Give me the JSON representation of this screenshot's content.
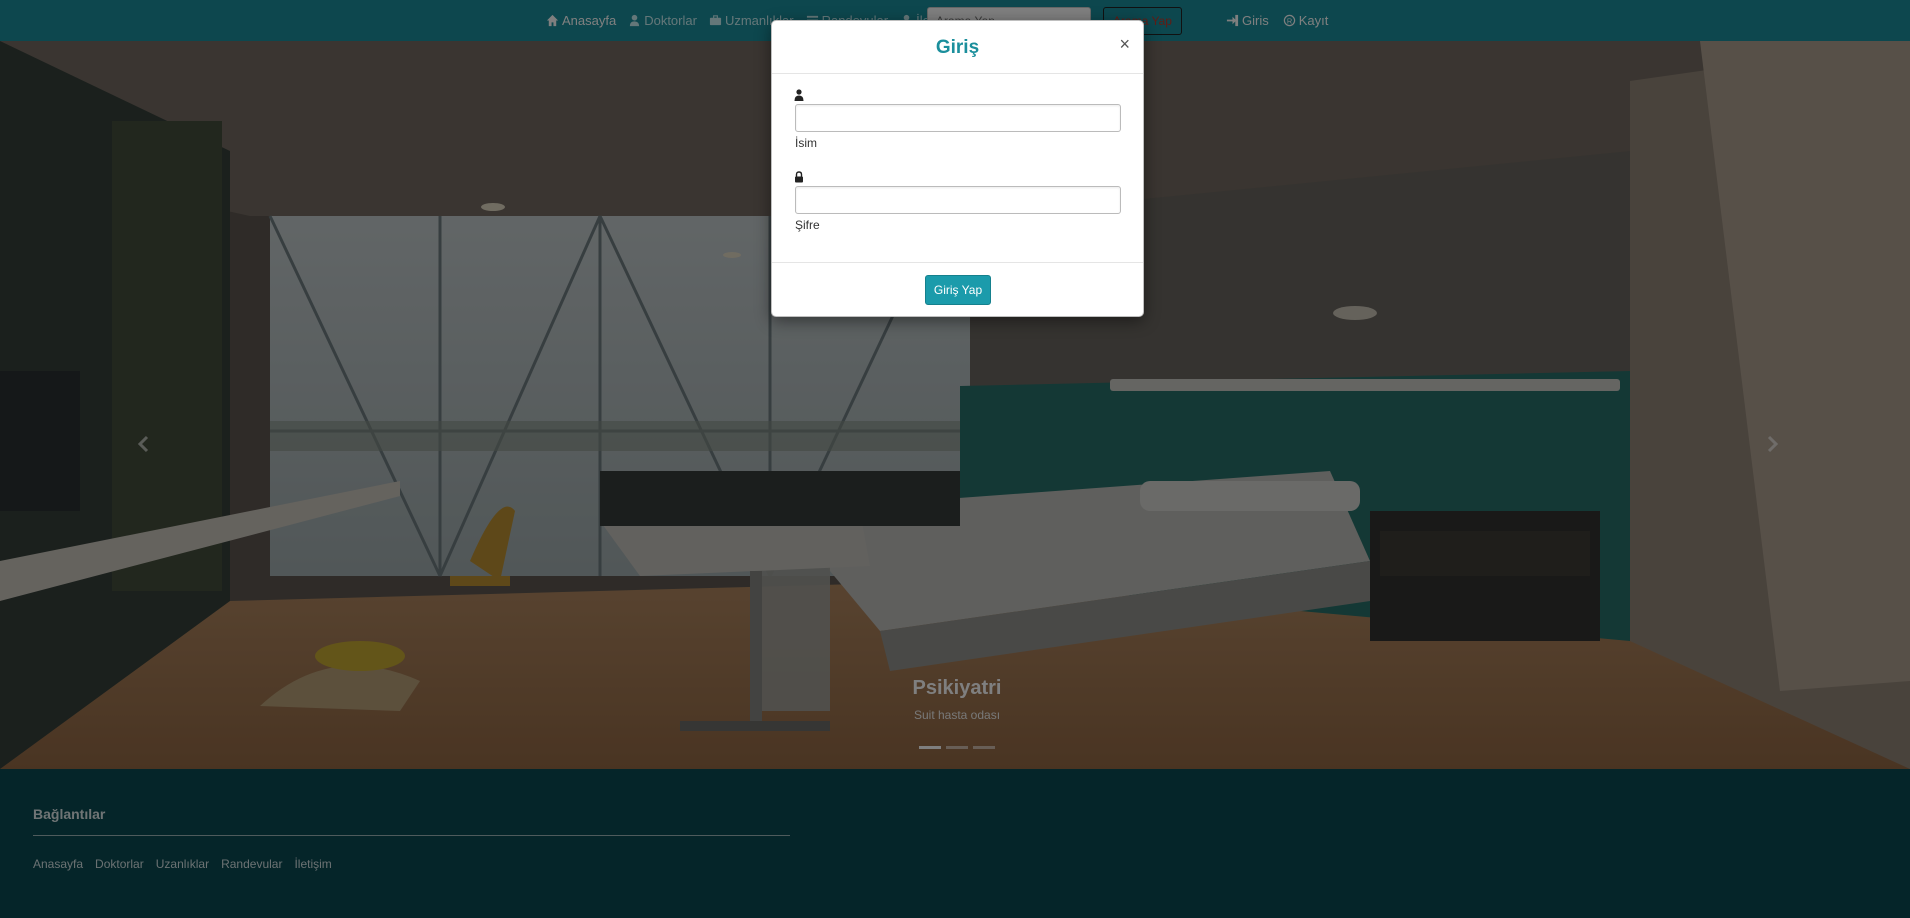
{
  "navbar": {
    "items": [
      {
        "label": "Anasayfa",
        "icon": "home-icon"
      },
      {
        "label": "Doktorlar",
        "icon": "user-md-icon"
      },
      {
        "label": "Uzmanlıklar",
        "icon": "briefcase-icon"
      },
      {
        "label": "Randevular",
        "icon": "list-icon"
      },
      {
        "label": "İletişim",
        "icon": "user-icon"
      }
    ],
    "search_placeholder": "Arama Yap",
    "search_button": "Arama Yap",
    "login_label": "Giris",
    "register_label": "Kayıt"
  },
  "carousel": {
    "caption_title": "Psikiyatri",
    "caption_subtitle": "Suit hasta odası",
    "slide_count": 3,
    "active_index": 0,
    "prev_icon": "chevron-left-icon",
    "next_icon": "chevron-right-icon"
  },
  "modal": {
    "title": "Giriş",
    "close_symbol": "×",
    "username_icon": "user-icon",
    "username_label": "İsim",
    "username_value": "",
    "password_icon": "lock-icon",
    "password_label": "Şifre",
    "password_value": "",
    "submit_label": "Giriş Yap"
  },
  "footer": {
    "heading": "Bağlantılar",
    "links": [
      "Anasayfa",
      "Doktorlar",
      "Uzanlıklar",
      "Randevular",
      "İletişim"
    ]
  },
  "colors": {
    "accent": "#1b8f9c",
    "footer_bg": "#0b4a52",
    "button": "#1b9bab"
  }
}
